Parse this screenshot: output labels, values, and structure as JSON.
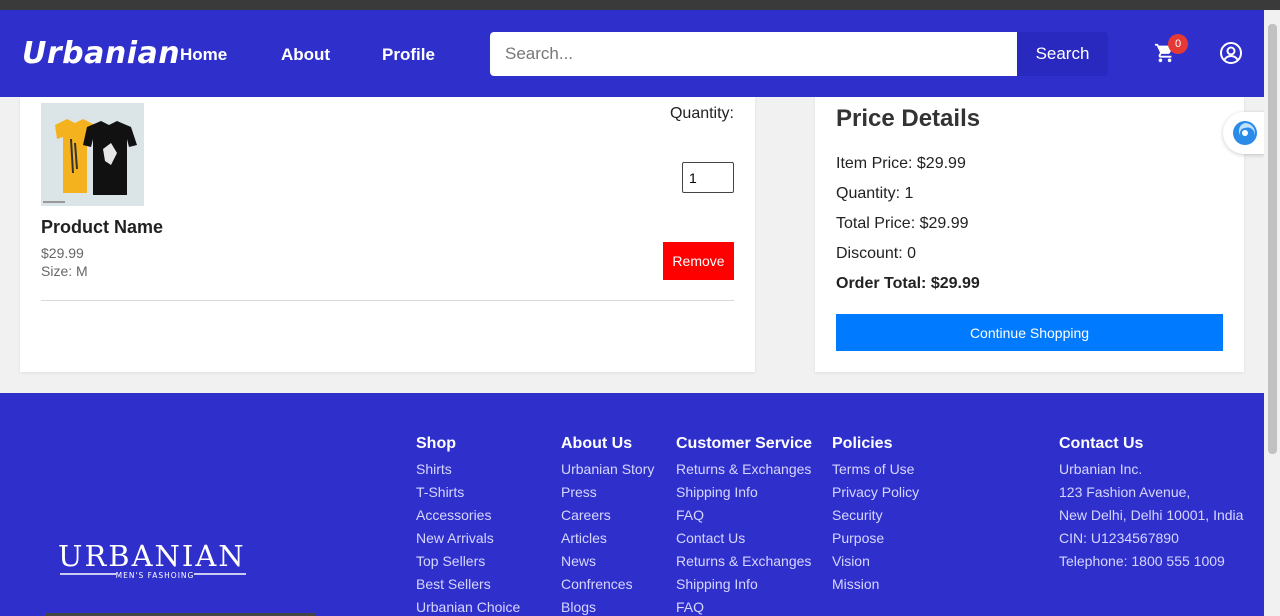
{
  "header": {
    "logo": "Urbanian",
    "nav": [
      "Home",
      "About",
      "Profile"
    ],
    "search": {
      "placeholder": "Search...",
      "button_label": "Search"
    },
    "cart_count": "0",
    "brand_color": "#2f2fcc"
  },
  "cart": {
    "product": {
      "name": "Product Name",
      "price": "$29.99",
      "size": "Size: M"
    },
    "quantity_label": "Quantity:",
    "quantity_value": "1",
    "remove_label": "Remove"
  },
  "price_details": {
    "title": "Price Details",
    "item_price": "Item Price: $29.99",
    "quantity": "Quantity: 1",
    "total_price": "Total Price: $29.99",
    "discount": "Discount: 0",
    "order_total": "Order Total: $29.99",
    "continue_label": "Continue Shopping"
  },
  "footer": {
    "brand": "URBANIAN",
    "brand_tagline": "MEN'S FASHOING",
    "columns": [
      {
        "heading": "Shop",
        "links": [
          "Shirts",
          "T-Shirts",
          "Accessories",
          "New Arrivals",
          "Top Sellers",
          "Best Sellers",
          "Urbanian Choice"
        ]
      },
      {
        "heading": "About Us",
        "links": [
          "Urbanian Story",
          "Press",
          "Careers",
          "Articles",
          "News",
          "Confrences",
          "Blogs"
        ]
      },
      {
        "heading": "Customer Service",
        "links": [
          "Returns & Exchanges",
          "Shipping Info",
          "FAQ",
          "Contact Us",
          "Returns & Exchanges",
          "Shipping Info",
          "FAQ"
        ]
      },
      {
        "heading": "Policies",
        "links": [
          "Terms of Use",
          "Privacy Policy",
          "Security",
          "Purpose",
          "Vision",
          "Mission"
        ]
      }
    ],
    "contact": {
      "heading": "Contact Us",
      "lines": [
        "Urbanian Inc.",
        "123 Fashion Avenue,",
        "New Delhi, Delhi 10001, India",
        "CIN: U1234567890",
        "Telephone: 1800 555 1009"
      ]
    }
  }
}
